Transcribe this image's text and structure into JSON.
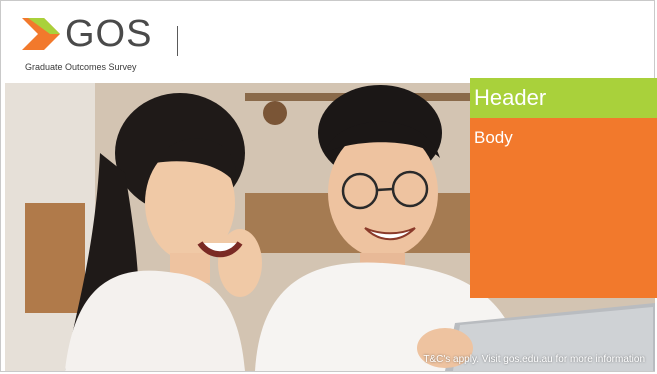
{
  "brand": {
    "name": "GOS",
    "tagline": "Graduate Outcomes Survey",
    "colors": {
      "green": "#a9d13b",
      "orange": "#f2792c",
      "text": "#4a4a4a"
    }
  },
  "panel": {
    "header": "Header",
    "body": "Body"
  },
  "hero": {
    "alt_icon": "photo-two-students-laughing"
  },
  "footer": {
    "disclaimer": "T&C's apply. Visit gos.edu.au for more information"
  }
}
